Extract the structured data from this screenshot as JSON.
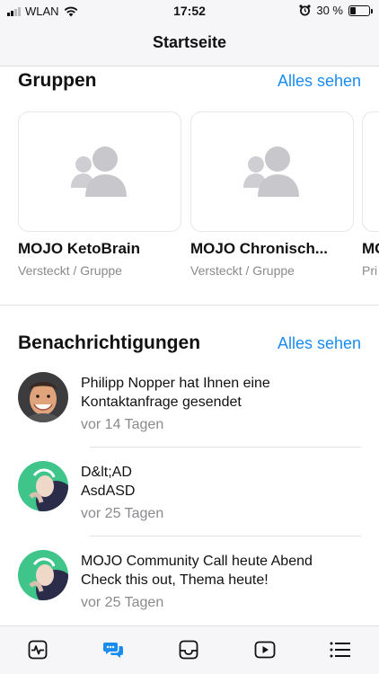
{
  "status_bar": {
    "carrier": "WLAN",
    "time": "17:52",
    "battery": "30 %",
    "battery_level": 0.3
  },
  "nav": {
    "title": "Startseite"
  },
  "groups_section": {
    "title": "Gruppen",
    "see_all": "Alles sehen",
    "items": [
      {
        "name": "MOJO KetoBrain",
        "meta": "Versteckt / Gruppe"
      },
      {
        "name": "MOJO Chronisch...",
        "meta": "Versteckt / Gruppe"
      },
      {
        "name": "MO",
        "meta": "Pri"
      }
    ]
  },
  "notifications_section": {
    "title": "Benachrichtigungen",
    "see_all": "Alles sehen",
    "items": [
      {
        "line1": "Philipp Nopper hat Ihnen eine",
        "line2": "Kontaktanfrage gesendet",
        "time": "vor 14 Tagen"
      },
      {
        "line1": "D&lt;AD",
        "line2": "AsdASD",
        "time": "vor 25 Tagen"
      },
      {
        "line1": "MOJO Community Call heute Abend",
        "line2": "Check this out, Thema heute!",
        "time": "vor 25 Tagen"
      }
    ]
  },
  "tab_bar": {
    "active_color": "#1a8cf0",
    "icons": [
      "activity-icon",
      "chat-bubbles-icon",
      "inbox-icon",
      "video-icon",
      "menu-icon"
    ]
  }
}
